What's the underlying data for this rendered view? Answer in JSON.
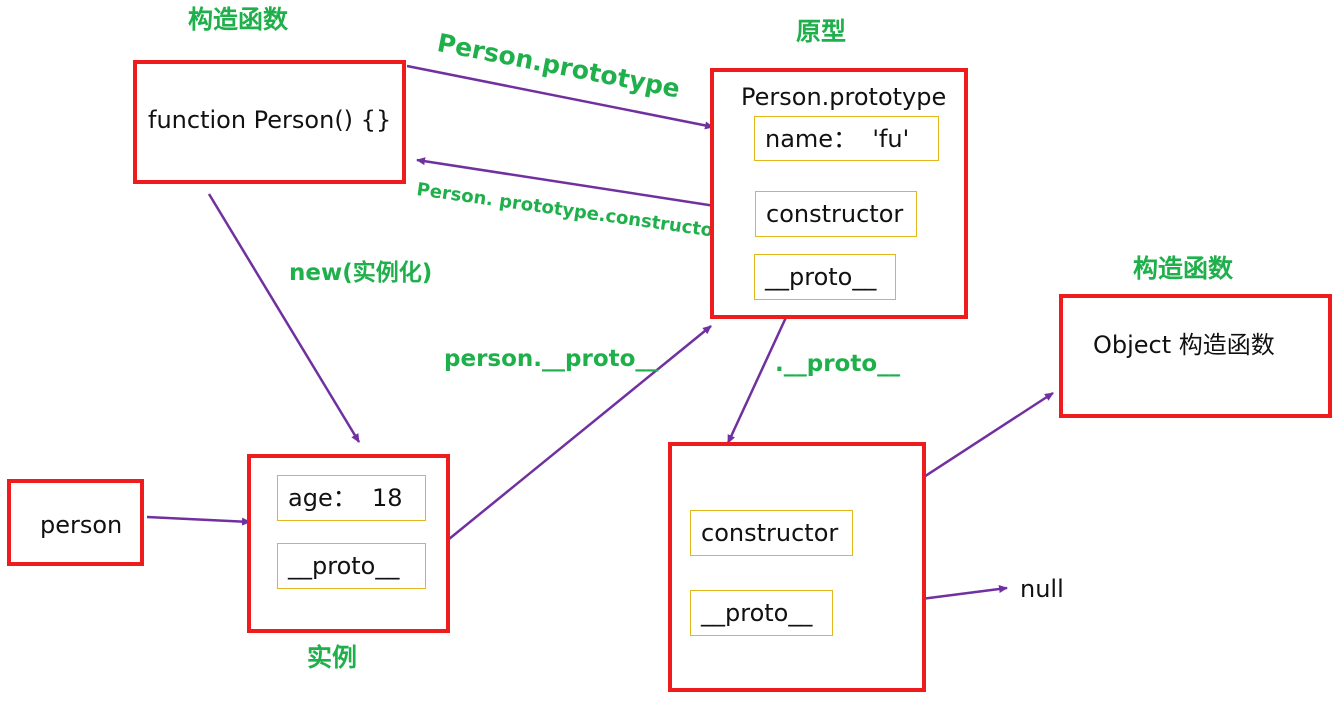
{
  "colors": {
    "box_border": "#ee1c1c",
    "slot_border": "#e3b619",
    "label": "#1fb04c",
    "arrow": "#7030a0"
  },
  "labels": {
    "constructor_title_1": "构造函数",
    "prototype_title": "原型",
    "constructor_title_2": "构造函数",
    "instance_title": "实例",
    "arrow_prototype": "Person.prototype",
    "arrow_constructor": "Person. prototype.constructor",
    "arrow_new": "new(实例化)",
    "arrow_person_proto": "person.__proto__",
    "arrow_proto": ".__proto__"
  },
  "nodes": {
    "person_fn": "function Person() {}",
    "prototype_title": "Person.prototype",
    "prototype_name": "name：  'fu'",
    "prototype_constructor": "constructor",
    "prototype_proto": "__proto__",
    "person_var": "person",
    "instance_age": "age：  18",
    "instance_proto": "__proto__",
    "object_proto_constructor": "constructor",
    "object_proto_proto": "__proto__",
    "object_ctor": "Object 构造函数",
    "null_text": "null"
  }
}
